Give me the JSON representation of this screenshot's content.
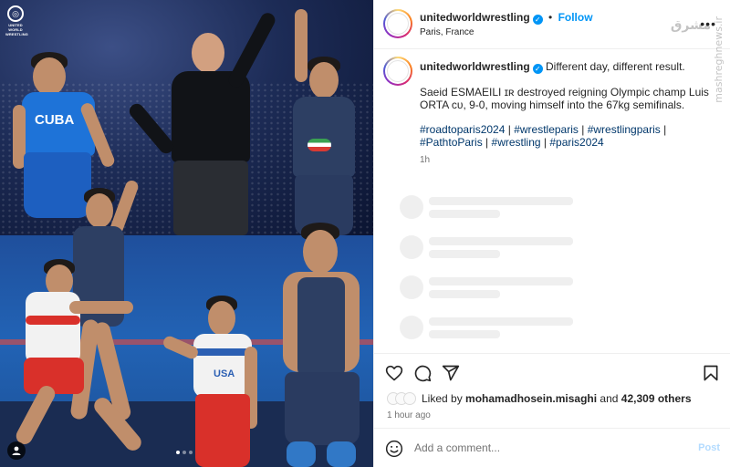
{
  "post": {
    "username": "unitedworldwrestling",
    "location": "Paris, France",
    "follow_label": "Follow",
    "more_label": "•••",
    "verified_glyph": "✓"
  },
  "media": {
    "logo_text": "UNITED WORLD WRESTLING",
    "cuba_text": "CUBA",
    "usa_text": "USA",
    "carousel_count": 3,
    "carousel_active": 1
  },
  "caption": {
    "username": "unitedworldwrestling",
    "headline": "Different day, different result.",
    "body": "Saeid ESMAEILI ɪʀ destroyed reigning Olympic champ Luis ORTA ᴄᴜ, 9-0, moving himself into the 67kg semifinals.",
    "hashtags": [
      "#roadtoparis2024",
      "#wrestleparis",
      "#wrestlingparis",
      "#PathtoParis",
      "#wrestling",
      "#paris2024"
    ],
    "separator": " | ",
    "time": "1h"
  },
  "watermark": {
    "site": "mashreghnews.ir",
    "fa": "مشرق"
  },
  "actions": {
    "icons": [
      "heart-icon",
      "comment-icon",
      "share-icon",
      "bookmark-icon"
    ],
    "liked_by_prefix": "Liked by",
    "liked_by_user": "mohamadhosein.misaghi",
    "and_label": "and",
    "others_count": "42,309 others",
    "post_time": "1 hour ago"
  },
  "comment": {
    "placeholder": "Add a comment...",
    "post_label": "Post"
  },
  "colors": {
    "accent": "#0095f6",
    "hashtag": "#00376b",
    "muted": "#737373",
    "post_disabled": "#b3dbff"
  }
}
